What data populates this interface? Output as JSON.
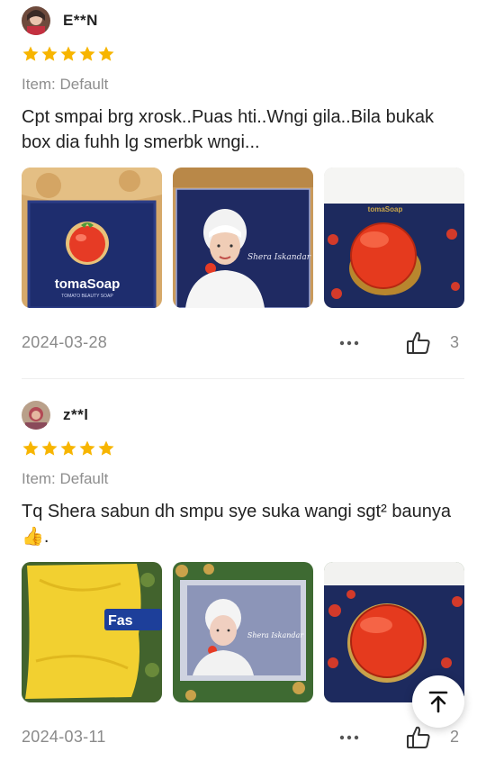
{
  "reviews": [
    {
      "user": "E**N",
      "rating": 5,
      "variant": "Item: Default",
      "text": "Cpt smpai brg xrosk..Puas hti..Wngi gila..Bila bukak box dia fuhh lg smerbk wngi...",
      "photos": [
        {
          "brand": "tomaSoap",
          "caption": "TOMATO BEAUTY SOAP"
        },
        {
          "signature": "Shera Iskandar"
        },
        {
          "brand": "tomaSoap"
        }
      ],
      "date": "2024-03-28",
      "likes": "3"
    },
    {
      "user": "z**l",
      "rating": 5,
      "variant": "Item: Default",
      "text": "Tq Shera sabun dh smpu sye suka wangi sgt² baunya👍.",
      "photos": [
        {
          "label": "Fas"
        },
        {
          "signature": "Shera Iskandar"
        },
        {}
      ],
      "date": "2024-03-11",
      "likes": "2"
    }
  ],
  "colors": {
    "star": "#f7b500",
    "muted": "#8a8a8a",
    "tomato": "#e63b25",
    "box": "#1e2d6e"
  },
  "icons": {
    "more": "more-dots-icon",
    "like": "thumbs-up-icon",
    "top": "back-to-top-icon"
  }
}
